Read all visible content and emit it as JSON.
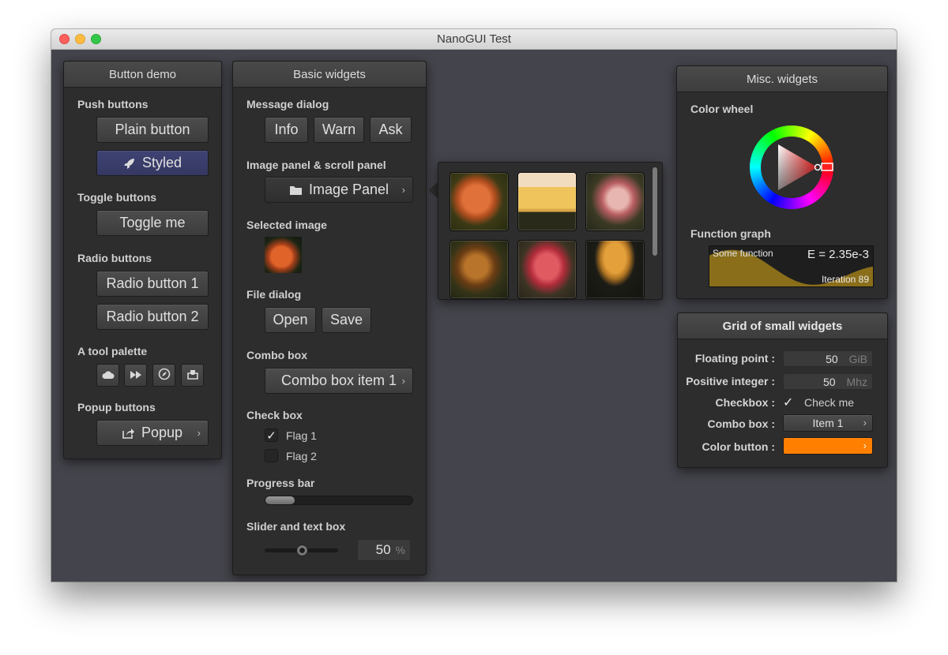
{
  "window": {
    "title": "NanoGUI Test"
  },
  "button_demo": {
    "title": "Button demo",
    "push_label": "Push buttons",
    "plain_button": "Plain button",
    "styled_button": "Styled",
    "toggle_label": "Toggle buttons",
    "toggle_button": "Toggle me",
    "radio_label": "Radio buttons",
    "radio_1": "Radio button 1",
    "radio_2": "Radio button 2",
    "palette_label": "A tool palette",
    "tools": [
      "cloud-icon",
      "fast-forward-icon",
      "compass-icon",
      "inbox-icon"
    ],
    "popup_label": "Popup buttons",
    "popup_button": "Popup"
  },
  "basic_widgets": {
    "title": "Basic widgets",
    "message_label": "Message dialog",
    "info": "Info",
    "warn": "Warn",
    "ask": "Ask",
    "image_panel_label": "Image panel & scroll panel",
    "image_panel_button": "Image Panel",
    "selected_image_label": "Selected image",
    "file_dialog_label": "File dialog",
    "open": "Open",
    "save": "Save",
    "combo_label": "Combo box",
    "combo_value": "Combo box item 1",
    "checkbox_label": "Check box",
    "flag1": "Flag 1",
    "flag1_checked": true,
    "flag2": "Flag 2",
    "flag2_checked": false,
    "progress_label": "Progress bar",
    "progress_fraction": 0.2,
    "slider_label": "Slider and text box",
    "slider_fraction": 0.5,
    "slider_value": "50",
    "slider_unit": "%"
  },
  "image_popup": {
    "images": [
      "sushi-1",
      "sushi-2",
      "sushi-3",
      "sushi-4",
      "sushi-5",
      "sushi-6"
    ]
  },
  "misc_widgets": {
    "title": "Misc. widgets",
    "color_wheel_label": "Color wheel",
    "function_graph_label": "Function graph",
    "graph_caption": "Some function",
    "graph_header": "E = 2.35e-3",
    "graph_footer": "Iteration 89",
    "graph_fill_color": "#8a6e1a"
  },
  "grid_widgets": {
    "title": "Grid of small widgets",
    "float_label": "Floating point :",
    "float_value": "50",
    "float_unit": "GiB",
    "int_label": "Positive integer :",
    "int_value": "50",
    "int_unit": "Mhz",
    "checkbox_label": "Checkbox :",
    "checkbox_text": "Check me",
    "checkbox_checked": true,
    "combo_label": "Combo box :",
    "combo_value": "Item 1",
    "color_label": "Color button :",
    "color_value": "#ff7f00"
  }
}
